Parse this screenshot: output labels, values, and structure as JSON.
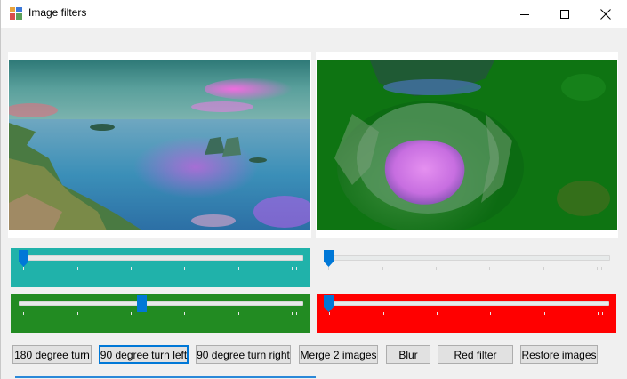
{
  "window": {
    "title": "Image filters",
    "icon": "app-icon",
    "controls": [
      "minimize-icon",
      "maximize-icon",
      "close-icon"
    ]
  },
  "images": {
    "left": "seascape photo with sunset sky, rocks and ocean",
    "right": "aerial photo of cave opening with water, green tint"
  },
  "sliders": [
    {
      "id": "slider-top-left",
      "panel_color": "#20b2aa",
      "value": 0.0
    },
    {
      "id": "slider-top-right",
      "panel_color": "#f0f0f0",
      "value": 0.0
    },
    {
      "id": "slider-bottom-left",
      "panel_color": "#228b22",
      "value": 0.43
    },
    {
      "id": "slider-bottom-right",
      "panel_color": "#ff0000",
      "value": 0.0
    }
  ],
  "buttons": [
    {
      "label": "180 degree turn"
    },
    {
      "label": "90 degree turn left",
      "focused": true
    },
    {
      "label": "90 degree turn right"
    },
    {
      "label": "Merge 2 images"
    },
    {
      "label": "Blur"
    },
    {
      "label": "Red filter"
    },
    {
      "label": "Restore images"
    }
  ],
  "colors": {
    "accent": "#0078d7",
    "button_bg": "#e1e1e1",
    "button_border": "#adadad"
  }
}
